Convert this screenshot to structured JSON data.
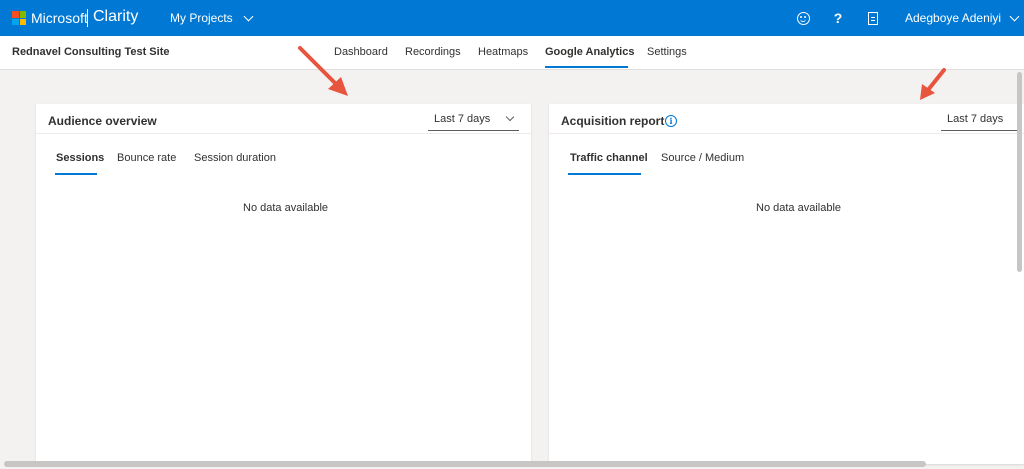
{
  "topbar": {
    "brand": "Microsoft",
    "product": "Clarity",
    "projects_label": "My Projects",
    "user_name": "Adegboye Adeniyi",
    "bg_color": "#0078d4"
  },
  "subnav": {
    "site_name": "Rednavel Consulting Test Site",
    "tabs": [
      {
        "label": "Dashboard"
      },
      {
        "label": "Recordings"
      },
      {
        "label": "Heatmaps"
      },
      {
        "label": "Google Analytics",
        "active": true
      },
      {
        "label": "Settings"
      }
    ]
  },
  "audience": {
    "title": "Audience overview",
    "range": "Last 7 days",
    "tabs": [
      {
        "label": "Sessions",
        "active": true
      },
      {
        "label": "Bounce rate"
      },
      {
        "label": "Session duration"
      }
    ],
    "empty": "No data available"
  },
  "acquisition": {
    "title": "Acquisition report",
    "range": "Last 7 days",
    "tabs": [
      {
        "label": "Traffic channel",
        "active": true
      },
      {
        "label": "Source / Medium"
      }
    ],
    "empty": "No data available"
  },
  "icons": [
    "feedback-smile-icon",
    "help-icon",
    "document-icon",
    "info-icon",
    "chevron-down-icon"
  ]
}
